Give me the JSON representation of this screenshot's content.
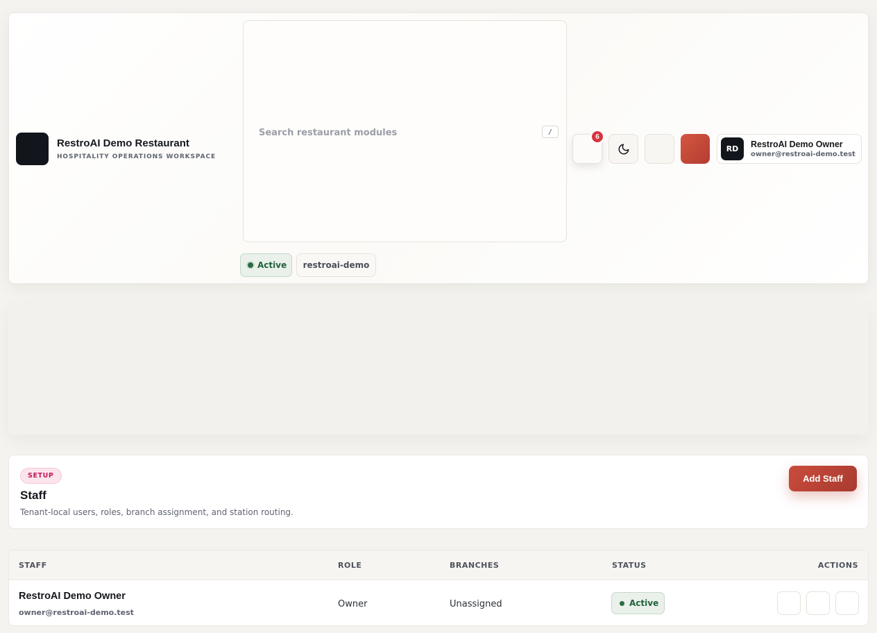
{
  "brand": {
    "name": "RestroAI Demo Restaurant",
    "subtitle": "HOSPITALITY OPERATIONS WORKSPACE"
  },
  "search": {
    "placeholder": "Search restaurant modules",
    "shortcut": "/"
  },
  "workspace": {
    "status": "Active",
    "tenant": "restroai-demo"
  },
  "notifications": {
    "count": "6"
  },
  "user": {
    "initials": "RD",
    "name": "RestroAI Demo Owner",
    "email": "owner@restroai-demo.test"
  },
  "page": {
    "tag": "SETUP",
    "title": "Staff",
    "description": "Tenant-local users, roles, branch assignment, and station routing.",
    "add_button": "Add Staff"
  },
  "table": {
    "columns": {
      "staff": "STAFF",
      "role": "ROLE",
      "branches": "BRANCHES",
      "status": "STATUS",
      "actions": "ACTIONS"
    },
    "rows": [
      {
        "name": "RestroAI Demo Owner",
        "email": "owner@restroai-demo.test",
        "role": "Owner",
        "branches": "Unassigned",
        "status": "Active"
      }
    ]
  },
  "colors": {
    "accent": "#c94c3c",
    "active_green": "#22613d",
    "badge_red": "#d7343f",
    "dark": "#12151b"
  },
  "icons": {
    "theme_toggle": "moon-icon"
  }
}
